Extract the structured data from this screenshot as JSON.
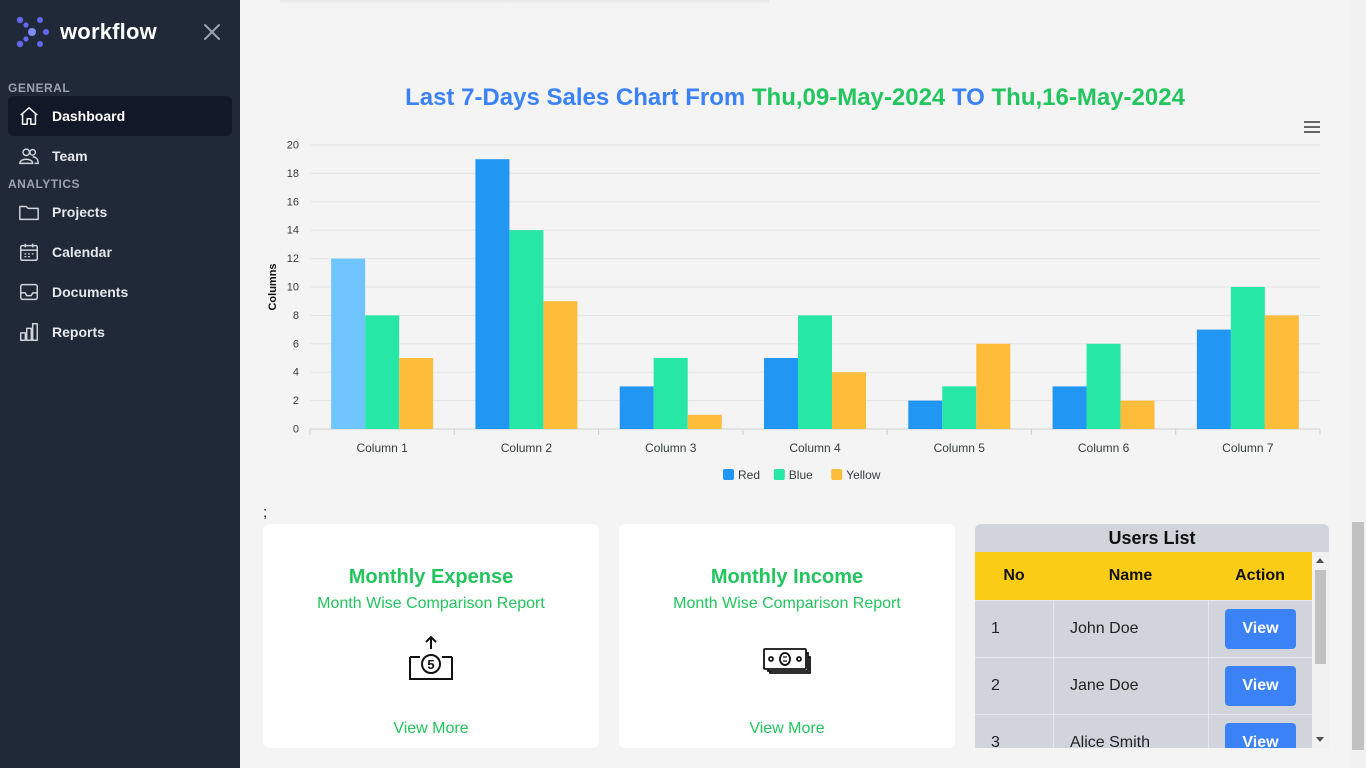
{
  "brand": {
    "name": "workflow"
  },
  "sidebar": {
    "sections": [
      {
        "title": "GENERAL"
      },
      {
        "title": "ANALYTICS"
      }
    ],
    "items": [
      {
        "label": "Dashboard",
        "icon": "home-icon"
      },
      {
        "label": "Team",
        "icon": "users-icon"
      },
      {
        "label": "Projects",
        "icon": "folder-icon"
      },
      {
        "label": "Calendar",
        "icon": "calendar-icon"
      },
      {
        "label": "Documents",
        "icon": "inbox-icon"
      },
      {
        "label": "Reports",
        "icon": "chart-icon"
      }
    ]
  },
  "chart_header": {
    "prefix": "Last 7-Days Sales Chart From ",
    "from": "Thu,09-May-2024",
    "to_word": " TO ",
    "to": "Thu,16-May-2024"
  },
  "chart_data": {
    "type": "bar",
    "title": "Last 7-Days Sales Chart From Thu,09-May-2024 TO Thu,16-May-2024",
    "xlabel": "",
    "ylabel": "Columns",
    "ylim": [
      0,
      20
    ],
    "yticks": [
      0,
      2,
      4,
      6,
      8,
      10,
      12,
      14,
      16,
      18,
      20
    ],
    "categories": [
      "Column 1",
      "Column 2",
      "Column 3",
      "Column 4",
      "Column 5",
      "Column 6",
      "Column 7"
    ],
    "series": [
      {
        "name": "Red",
        "color": "#2196f3",
        "values": [
          12,
          19,
          3,
          5,
          2,
          3,
          7
        ]
      },
      {
        "name": "Blue",
        "color": "#26e7a6",
        "values": [
          8,
          14,
          5,
          8,
          3,
          6,
          10
        ]
      },
      {
        "name": "Yellow",
        "color": "#febc3b",
        "values": [
          5,
          9,
          1,
          4,
          6,
          2,
          8
        ]
      }
    ],
    "highlight": {
      "series": 0,
      "index": 0,
      "color": "#6ec5ff"
    },
    "grid": true,
    "legend": "bottom-center"
  },
  "misc": {
    "stray_text": ";"
  },
  "cards": [
    {
      "title": "Monthly Expense",
      "subtitle": "Month Wise Comparison Report",
      "icon": "coin-out-of-box-icon",
      "link": "View More"
    },
    {
      "title": "Monthly Income",
      "subtitle": "Month Wise Comparison Report",
      "icon": "cash-stack-icon",
      "link": "View More"
    }
  ],
  "users": {
    "title": "Users List",
    "columns": [
      "No",
      "Name",
      "Action"
    ],
    "rows": [
      {
        "no": "1",
        "name": "John Doe",
        "action": "View"
      },
      {
        "no": "2",
        "name": "Jane Doe",
        "action": "View"
      },
      {
        "no": "3",
        "name": "Alice Smith",
        "action": "View"
      }
    ]
  }
}
